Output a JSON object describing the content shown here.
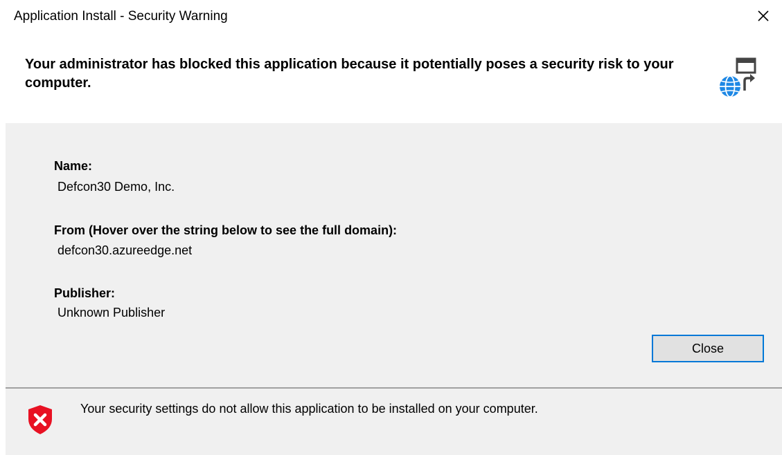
{
  "window": {
    "title": "Application Install - Security Warning",
    "close_icon": "close-icon"
  },
  "header": {
    "message": "Your administrator has blocked this application because it potentially poses a security risk to your computer.",
    "icon": "web-application-install-icon"
  },
  "details": {
    "name": {
      "label": "Name:",
      "value": "Defcon30 Demo, Inc."
    },
    "from": {
      "label": "From (Hover over the string below to see the full domain):",
      "value": "defcon30.azureedge.net"
    },
    "publisher": {
      "label": "Publisher:",
      "value": "Unknown Publisher"
    }
  },
  "buttons": {
    "close_label": "Close"
  },
  "footer": {
    "message": "Your security settings do not allow this application to be installed on your computer.",
    "icon": "shield-error-icon"
  },
  "colors": {
    "accent_blue": "#0078d7",
    "panel_gray": "#f0f0f0",
    "error_red": "#e81123",
    "globe_blue": "#1e88e5",
    "icon_dark": "#444444"
  }
}
